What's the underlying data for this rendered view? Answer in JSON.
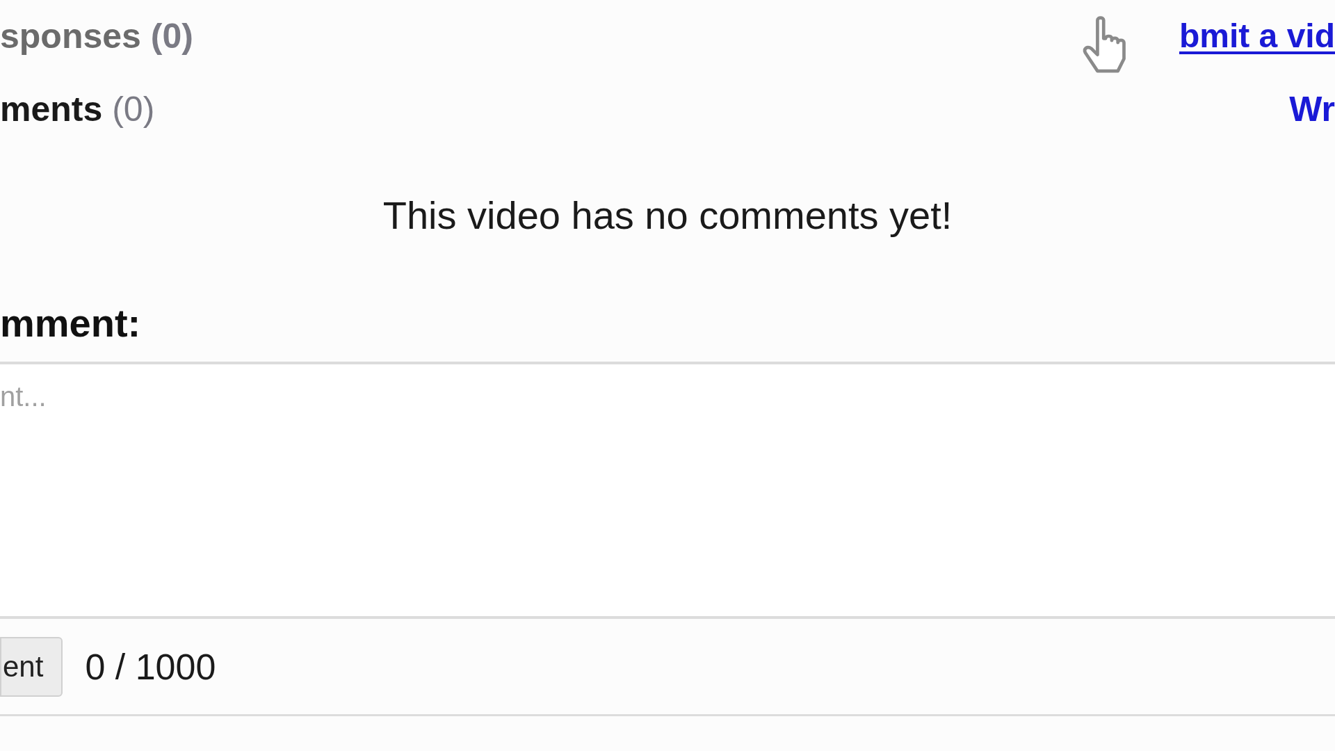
{
  "video_responses": {
    "label": "sponses",
    "count": "(0)"
  },
  "submit_link": "bmit a vid",
  "comments_header": {
    "label": "ments",
    "count": "(0)"
  },
  "write_link": "Wr",
  "empty_message": "This video has no comments yet!",
  "comment_form": {
    "label": "mment:",
    "placeholder": "nt...",
    "button": "ent",
    "counter": "0 / 1000"
  }
}
